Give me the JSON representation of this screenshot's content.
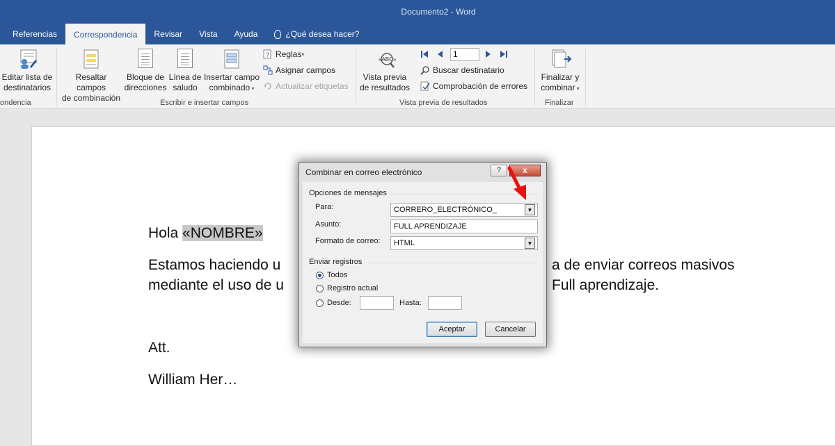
{
  "window": {
    "title": "Documento2  -  Word"
  },
  "tabs": [
    {
      "label": "Referencias"
    },
    {
      "label": "Correspondencia"
    },
    {
      "label": "Revisar"
    },
    {
      "label": "Vista"
    },
    {
      "label": "Ayuda"
    },
    {
      "label": "¿Qué desea hacer?"
    }
  ],
  "ribbon": {
    "group1": {
      "label": "ondencia",
      "edit_list": [
        "Editar lista de",
        "destinatarios"
      ]
    },
    "group2": {
      "label": "Escribir e insertar campos",
      "highlight": [
        "Resaltar campos",
        "de combinación"
      ],
      "address_block": [
        "Bloque de",
        "direcciones"
      ],
      "greeting_line": [
        "Línea de",
        "saludo"
      ],
      "insert_field": [
        "Insertar campo",
        "combinado"
      ],
      "rules": "Reglas",
      "assign_fields": "Asignar campos",
      "update_labels": "Actualizar etiquetas"
    },
    "group3": {
      "label": "Vista previa de resultados",
      "preview": [
        "Vista previa",
        "de resultados"
      ],
      "record_number": "1",
      "find_recipient": "Buscar destinatario",
      "check_errors": "Comprobación de errores"
    },
    "group4": {
      "label": "Finalizar",
      "finish": [
        "Finalizar y",
        "combinar"
      ]
    }
  },
  "document": {
    "greeting": "Hola ",
    "merge_field": "«NOMBRE»",
    "line1_left": "Estamos haciendo u",
    "line1_right": "a de enviar correos masivos",
    "line2_left": "mediante el uso de u",
    "line2_right": "Full aprendizaje.",
    "closing": "Att.",
    "signature": "William Her…"
  },
  "dialog": {
    "title": "Combinar en correo electrónico",
    "help": "?",
    "close": "x",
    "message_options": "Opciones de mensajes",
    "to_label": "Para:",
    "to_value": "CORRERO_ELECTRÓNICO_",
    "subject_label": "Asunto:",
    "subject_value": "FULL APRENDIZAJE",
    "format_label": "Formato de correo:",
    "format_value": "HTML",
    "send_records": "Enviar registros",
    "all_label": "Todos",
    "current_label": "Registro actual",
    "from_label": "Desde:",
    "to_range_label": "Hasta:",
    "accept": "Aceptar",
    "cancel": "Cancelar"
  },
  "colors": {
    "accent": "#2b579a",
    "arrow": "#e8120c"
  }
}
